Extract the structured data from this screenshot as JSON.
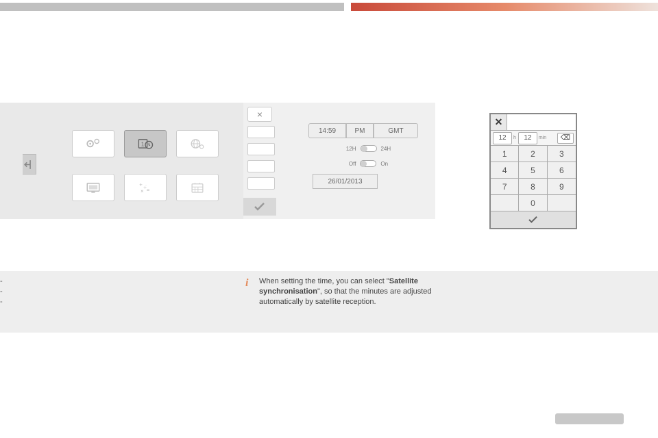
{
  "panel2": {
    "close_glyph": "×",
    "check_glyph": "✓",
    "time": {
      "value": "14:59",
      "ampm": "PM",
      "zone": "GMT"
    },
    "format_toggle": {
      "left": "12H",
      "right": "24H"
    },
    "sync_toggle": {
      "left": "Off",
      "right": "On"
    },
    "date": "26/01/2013"
  },
  "keypad": {
    "close_glyph": "✕",
    "hours": "12",
    "hours_unit": "h",
    "minutes": "12",
    "minutes_unit": "min",
    "backspace_glyph": "⌫",
    "keys": [
      "1",
      "2",
      "3",
      "4",
      "5",
      "6",
      "7",
      "8",
      "9",
      "",
      "0",
      ""
    ],
    "confirm_glyph": "✓"
  },
  "info": {
    "icon": "i",
    "text_pre": "When setting the time, you can select \"",
    "text_bold": "Satellite synchronisation",
    "text_post": "\", so that the minutes are adjusted automatically by satellite reception."
  },
  "left_steps": {
    "l1": "-",
    "l2": "-",
    "l3": "-"
  }
}
